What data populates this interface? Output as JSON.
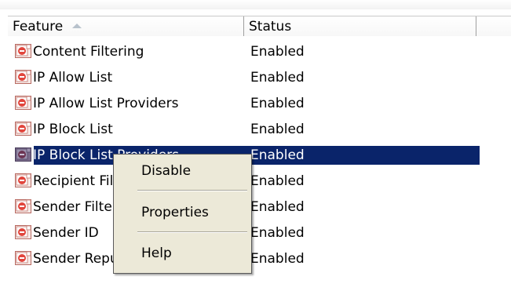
{
  "header": {
    "feature_label": "Feature",
    "status_label": "Status"
  },
  "rows": [
    {
      "name": "Content Filtering",
      "status": "Enabled"
    },
    {
      "name": "IP Allow List",
      "status": "Enabled"
    },
    {
      "name": "IP Allow List Providers",
      "status": "Enabled"
    },
    {
      "name": "IP Block List",
      "status": "Enabled"
    },
    {
      "name": "IP Block List Providers",
      "status": "Enabled"
    },
    {
      "name": "Recipient Filtering",
      "status": "Enabled"
    },
    {
      "name": "Sender Filtering",
      "status": "Enabled"
    },
    {
      "name": "Sender ID",
      "status": "Enabled"
    },
    {
      "name": "Sender Reputation",
      "status": "Enabled"
    }
  ],
  "context_menu": {
    "items": [
      "Disable",
      "Properties",
      "Help"
    ]
  },
  "icon": "agent-feature-icon",
  "colors": {
    "selection": "#0a246a",
    "menu_bg": "#ece9d8",
    "icon_red": "#e1453c"
  }
}
